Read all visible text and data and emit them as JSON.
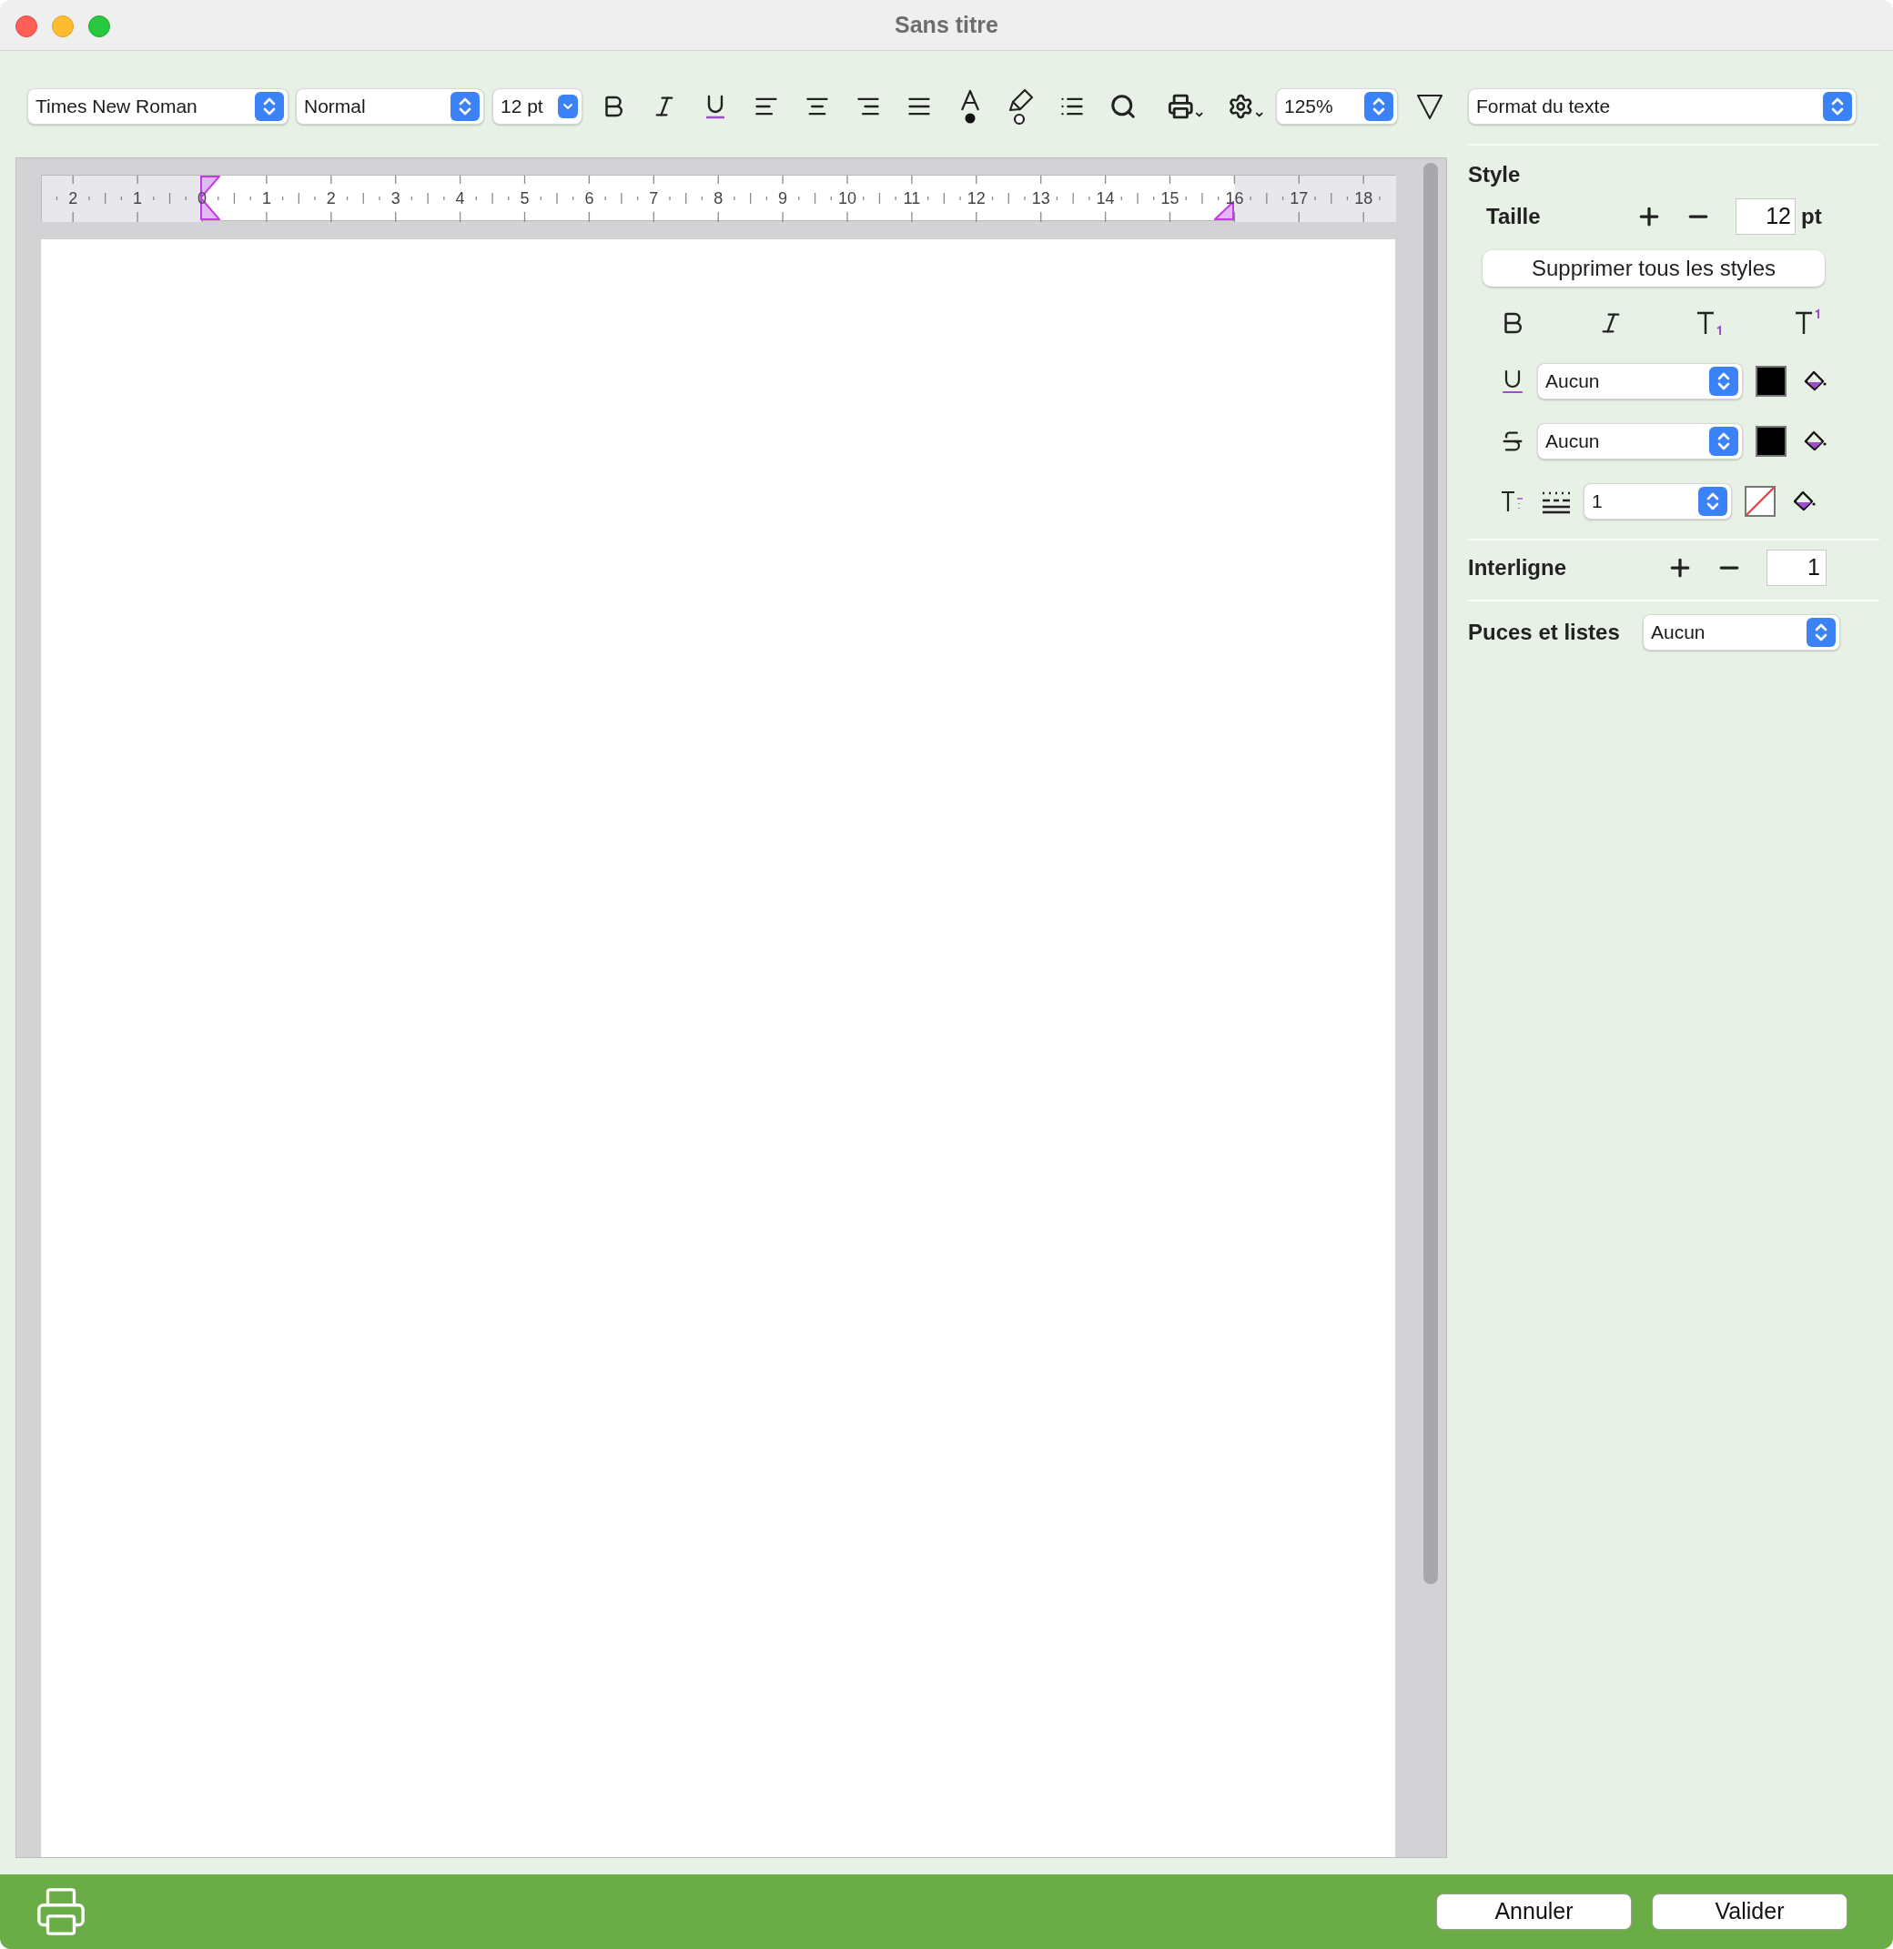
{
  "window": {
    "title": "Sans titre"
  },
  "toolbar": {
    "font": "Times New Roman",
    "paragraph_style": "Normal",
    "size": "12 pt",
    "zoom": "125%"
  },
  "format_select": "Format du texte",
  "ruler": {
    "labels": [
      "2",
      "1",
      "0",
      "1",
      "2",
      "3",
      "4",
      "5",
      "6",
      "7",
      "8",
      "9",
      "10",
      "11",
      "12",
      "13",
      "14",
      "15",
      "16",
      "17",
      "18"
    ]
  },
  "style_panel": {
    "heading": "Style",
    "size_label": "Taille",
    "size_value": "12",
    "size_unit": "pt",
    "clear_button": "Supprimer tous les styles",
    "underline": {
      "value": "Aucun",
      "color": "#000000"
    },
    "strikethrough": {
      "value": "Aucun",
      "color": "#000000"
    },
    "outline": {
      "value": "1"
    }
  },
  "line_spacing": {
    "label": "Interligne",
    "value": "1"
  },
  "bullets": {
    "label": "Puces et listes",
    "value": "Aucun"
  },
  "buttons": [
    {
      "label": "Annuler"
    },
    {
      "label": "Valider"
    }
  ]
}
